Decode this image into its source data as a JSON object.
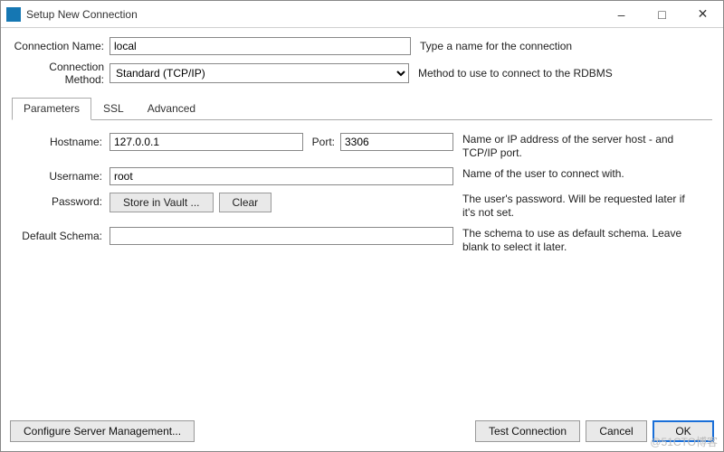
{
  "window": {
    "title": "Setup New Connection"
  },
  "top": {
    "connection_name_label": "Connection Name:",
    "connection_name_value": "local",
    "connection_name_help": "Type a name for the connection",
    "connection_method_label": "Connection Method:",
    "connection_method_value": "Standard (TCP/IP)",
    "connection_method_help": "Method to use to connect to the RDBMS"
  },
  "tabs": {
    "parameters": "Parameters",
    "ssl": "SSL",
    "advanced": "Advanced"
  },
  "params": {
    "hostname_label": "Hostname:",
    "hostname_value": "127.0.0.1",
    "port_label": "Port:",
    "port_value": "3306",
    "hostname_help": "Name or IP address of the server host - and TCP/IP port.",
    "username_label": "Username:",
    "username_value": "root",
    "username_help": "Name of the user to connect with.",
    "password_label": "Password:",
    "store_in_vault": "Store in Vault ...",
    "clear": "Clear",
    "password_help": "The user's password. Will be requested later if it's not set.",
    "default_schema_label": "Default Schema:",
    "default_schema_value": "",
    "default_schema_help": "The schema to use as default schema. Leave blank to select it later."
  },
  "footer": {
    "configure": "Configure Server Management...",
    "test": "Test Connection",
    "cancel": "Cancel",
    "ok": "OK"
  },
  "watermark": "@51CTO博客"
}
